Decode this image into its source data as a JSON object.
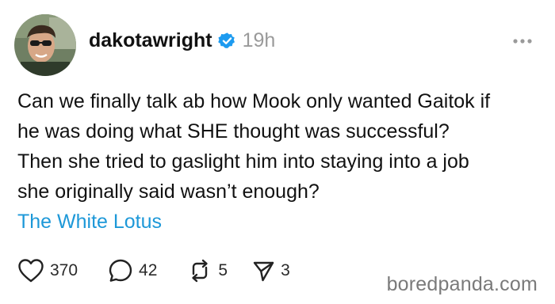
{
  "post": {
    "username": "dakotawright",
    "verified": true,
    "timestamp": "19h",
    "text_lines": [
      "Can we finally talk ab how Mook only wanted Gaitok if",
      "he was doing what SHE thought was successful?",
      "Then she tried to gaslight him into staying into a job",
      "she originally said wasn’t enough?"
    ],
    "topic": "The White Lotus",
    "actions": {
      "likes": "370",
      "replies": "42",
      "reposts": "5",
      "shares": "3"
    }
  },
  "watermark": "boredpanda.com",
  "icons": {
    "verified": "verified-badge-icon",
    "more": "more-options-icon",
    "like": "heart-icon",
    "reply": "comment-icon",
    "repost": "repost-icon",
    "share": "send-icon"
  },
  "colors": {
    "link": "#1d98d8",
    "verified_badge": "#1d9bf0",
    "timestamp": "#9a9a9a"
  }
}
